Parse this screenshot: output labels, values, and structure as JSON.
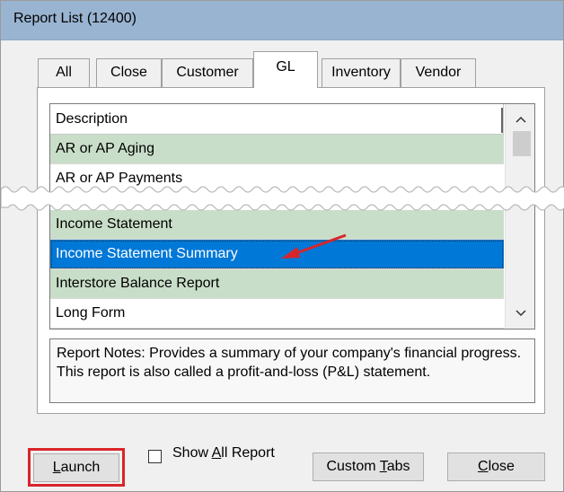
{
  "window": {
    "title": "Report List (12400)"
  },
  "tabs": [
    {
      "label": "All",
      "active": false
    },
    {
      "label": "Close",
      "active": false
    },
    {
      "label": "Customer",
      "active": false
    },
    {
      "label": "GL",
      "active": true
    },
    {
      "label": "Inventory",
      "active": false
    },
    {
      "label": "Vendor",
      "active": false
    }
  ],
  "list": {
    "header": "Description",
    "rows_top": [
      "AR or AP Aging",
      "AR or AP Payments"
    ],
    "rows_bottom": [
      "Income Statement",
      "Income Statement Summary",
      "Interstore Balance Report",
      "Long Form"
    ],
    "selected": "Income Statement Summary"
  },
  "notes": {
    "text": "Report Notes:  Provides a summary of your company's financial progress. This report is also called a profit-and-loss (P&L) statement."
  },
  "buttons": {
    "launch_prefix": "",
    "launch_mnemonic": "L",
    "launch_rest": "aunch",
    "show_all_prefix": "Show ",
    "show_all_mnemonic": "A",
    "show_all_rest": "ll Report",
    "custom_tabs_prefix": "Custom ",
    "custom_tabs_mnemonic": "T",
    "custom_tabs_rest": "abs",
    "close_mnemonic": "C",
    "close_rest": "lose"
  },
  "colors": {
    "accent_selection": "#0078d7",
    "row_green": "#c9dec9",
    "highlight_red": "#d9252a",
    "titlebar": "#99b4d1"
  },
  "icons": [
    "scroll-up-icon",
    "scroll-down-icon",
    "red-arrow-annotation"
  ]
}
